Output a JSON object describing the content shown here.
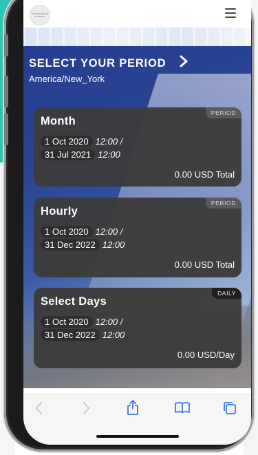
{
  "colors": {
    "accent": "#2a4594",
    "card": "#3c3c3c",
    "toolbar_icon": "#3a78f2"
  },
  "header": {
    "logo_text_top": "CONVENIENCE",
    "logo_text_bottom": "COMPANY",
    "menu_icon": "hamburger-menu-icon"
  },
  "hero": {
    "title": "SELECT YOUR PERIOD",
    "arrow_icon": "chevron-right-icon",
    "timezone": "America/New_York"
  },
  "cards": [
    {
      "title": "Month",
      "badge": "PERIOD",
      "start_date": "1 Oct 2020",
      "start_time": "12:00 /",
      "end_date": "31 Jul 2021",
      "end_time": "12:00",
      "total": "0.00 USD Total"
    },
    {
      "title": "Hourly",
      "badge": "PERIOD",
      "start_date": "1 Oct 2020",
      "start_time": "12:00 /",
      "end_date": "31 Dec 2022",
      "end_time": "12:00",
      "total": "0.00 USD Total"
    },
    {
      "title": "Select Days",
      "badge": "DAILY",
      "start_date": "1 Oct 2020",
      "start_time": "12:00 /",
      "end_date": "31 Dec 2022",
      "end_time": "12:00",
      "total": "0.00 USD/Day"
    }
  ],
  "toolbar": {
    "back_icon": "back-chevron-icon",
    "forward_icon": "forward-chevron-icon",
    "share_icon": "share-icon",
    "bookmarks_icon": "bookmarks-icon",
    "tabs_icon": "tabs-icon"
  }
}
